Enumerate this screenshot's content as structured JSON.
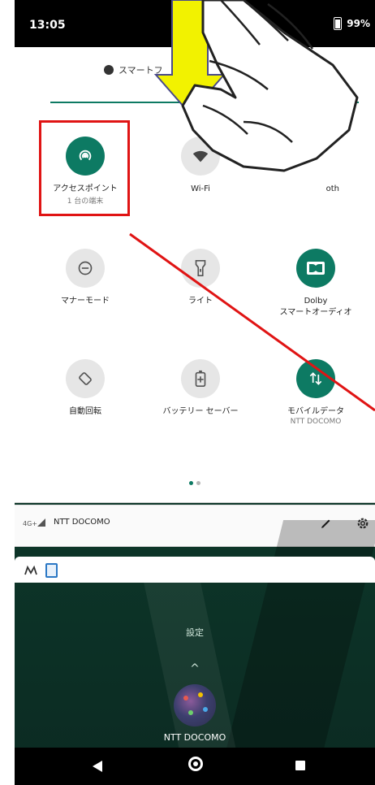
{
  "status_bar": {
    "time": "13:05",
    "battery": "99%"
  },
  "quick_settings": {
    "brightness_label": "スマートフ",
    "tiles": [
      {
        "label": "アクセスポイント",
        "sublabel": "1 台の端末",
        "icon": "hotspot-icon",
        "state": "on"
      },
      {
        "label": "Wi-Fi",
        "sublabel": "",
        "icon": "wifi-icon",
        "state": "off"
      },
      {
        "label": "oth",
        "sublabel": "",
        "icon": "bluetooth-icon",
        "state": "off"
      },
      {
        "label": "マナーモード",
        "sublabel": "",
        "icon": "do-not-disturb-icon",
        "state": "off"
      },
      {
        "label": "ライト",
        "sublabel": "",
        "icon": "flashlight-icon",
        "state": "off"
      },
      {
        "label": "Dolby\nスマートオーディオ",
        "sublabel": "",
        "icon": "dolby-icon",
        "state": "on"
      },
      {
        "label": "自動回転",
        "sublabel": "",
        "icon": "auto-rotate-icon",
        "state": "off"
      },
      {
        "label": "バッテリー セーバー",
        "sublabel": "",
        "icon": "battery-saver-icon",
        "state": "off"
      },
      {
        "label": "モバイルデータ",
        "sublabel": "NTT DOCOMO",
        "icon": "mobile-data-icon",
        "state": "on"
      }
    ],
    "page_indicator": {
      "pages": 2,
      "active": 0
    }
  },
  "carrier_row": {
    "network_type": "4G+",
    "carrier": "NTT DOCOMO"
  },
  "home_screen": {
    "folder_label": "設定",
    "app_label": "NTT DOCOMO"
  },
  "colors": {
    "accent": "#0d7a63",
    "annotation_red": "#e01414",
    "arrow_yellow": "#f2f200"
  }
}
